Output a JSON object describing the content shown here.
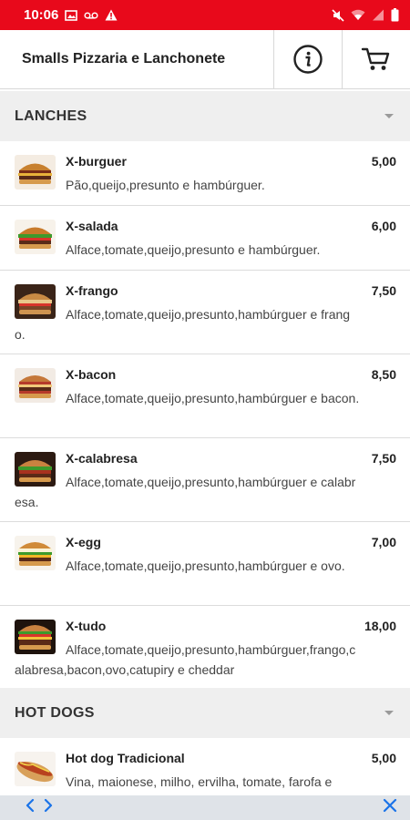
{
  "status": {
    "time": "10:06",
    "icons": [
      "image-icon",
      "voicemail-icon",
      "warning-icon",
      "mute-icon",
      "wifi-icon",
      "signal-icon",
      "battery-icon"
    ]
  },
  "header": {
    "title": "Smalls Pizzaria e Lanchonete",
    "info_icon": "info-icon",
    "cart_icon": "cart-icon"
  },
  "sections": [
    {
      "title": "LANCHES",
      "items": [
        {
          "name": "X-burguer",
          "price": "5,00",
          "description": "Pão,queijo,presunto e hambúrguer."
        },
        {
          "name": "X-salada",
          "price": "6,00",
          "description": "Alface,tomate,queijo,presunto e hambúrguer."
        },
        {
          "name": "X-frango",
          "price": "7,50",
          "description": "Alface,tomate,queijo,presunto,hambúrguer e frango."
        },
        {
          "name": "X-bacon",
          "price": "8,50",
          "description": "Alface,tomate,queijo,presunto,hambúrguer e bacon."
        },
        {
          "name": "X-calabresa",
          "price": "7,50",
          "description": "Alface,tomate,queijo,presunto,hambúrguer e calabresa."
        },
        {
          "name": "X-egg",
          "price": "7,00",
          "description": "Alface,tomate,queijo,presunto,hambúrguer e ovo."
        },
        {
          "name": "X-tudo",
          "price": "18,00",
          "description": "Alface,tomate,queijo,presunto,hambúrguer,frango,calabresa,bacon,ovo,catupiry e cheddar"
        }
      ]
    },
    {
      "title": "HOT DOGS",
      "items": [
        {
          "name": "Hot dog Tradicional",
          "price": "5,00",
          "description": "Vina, maionese, milho, ervilha, tomate, farofa e"
        }
      ]
    }
  ],
  "bottom_bar": {
    "back_icon": "chevron-left-icon",
    "forward_icon": "chevron-right-icon",
    "close_icon": "close-icon",
    "accent": "#1a73e8"
  },
  "colors": {
    "status_bar": "#e8091b",
    "section_bg": "#efefef"
  }
}
